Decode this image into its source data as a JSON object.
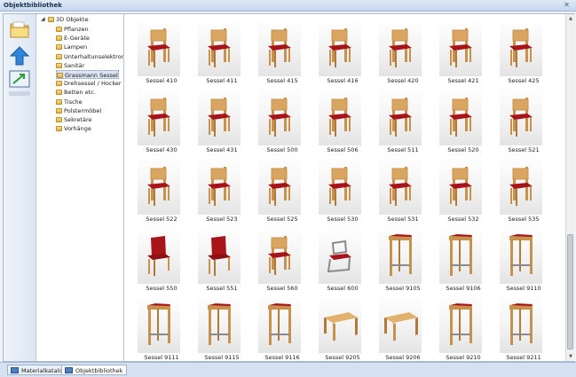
{
  "window": {
    "title": "Objektbibliothek"
  },
  "toolbar": {
    "items": [
      "folder-icon",
      "up-arrow-icon",
      "image-resize-icon"
    ]
  },
  "tree": {
    "root": "3D Objekte",
    "items": [
      "Pflanzen",
      "E-Geräte",
      "Lampen",
      "Unterhaltunselektronik",
      "Sanitär",
      "Grassmann Sessel",
      "Drehsessel / Hocker",
      "Betten etc.",
      "Tische",
      "Polstermöbel",
      "Sekretäre",
      "Vorhänge"
    ],
    "selected": "Grassmann Sessel"
  },
  "grid": {
    "items": [
      {
        "label": "Sessel 410",
        "kind": "chair"
      },
      {
        "label": "Sessel 411",
        "kind": "chair"
      },
      {
        "label": "Sessel 415",
        "kind": "chair"
      },
      {
        "label": "Sessel 416",
        "kind": "chair"
      },
      {
        "label": "Sessel 420",
        "kind": "chair"
      },
      {
        "label": "Sessel 421",
        "kind": "chair"
      },
      {
        "label": "Sessel 425",
        "kind": "chair"
      },
      {
        "label": "Sessel 430",
        "kind": "chair"
      },
      {
        "label": "Sessel 431",
        "kind": "chair"
      },
      {
        "label": "Sessel 500",
        "kind": "chair"
      },
      {
        "label": "Sessel 506",
        "kind": "chair"
      },
      {
        "label": "Sessel 511",
        "kind": "chair"
      },
      {
        "label": "Sessel 520",
        "kind": "chair"
      },
      {
        "label": "Sessel 521",
        "kind": "chair"
      },
      {
        "label": "Sessel 522",
        "kind": "chair"
      },
      {
        "label": "Sessel 523",
        "kind": "chair"
      },
      {
        "label": "Sessel 525",
        "kind": "chair"
      },
      {
        "label": "Sessel 530",
        "kind": "chair"
      },
      {
        "label": "Sessel 531",
        "kind": "chair"
      },
      {
        "label": "Sessel 532",
        "kind": "chair"
      },
      {
        "label": "Sessel 535",
        "kind": "chair"
      },
      {
        "label": "Sessel 550",
        "kind": "upholstered"
      },
      {
        "label": "Sessel 551",
        "kind": "upholstered"
      },
      {
        "label": "Sessel 560",
        "kind": "chair"
      },
      {
        "label": "Sessel 600",
        "kind": "cantilever"
      },
      {
        "label": "Sessel 9105",
        "kind": "stool"
      },
      {
        "label": "Sessel 9106",
        "kind": "stool"
      },
      {
        "label": "Sessel 9110",
        "kind": "stool"
      },
      {
        "label": "Sessel 9111",
        "kind": "stool"
      },
      {
        "label": "Sessel 9115",
        "kind": "stool"
      },
      {
        "label": "Sessel 9116",
        "kind": "stool"
      },
      {
        "label": "Sessel 9205",
        "kind": "bench"
      },
      {
        "label": "Sessel 9206",
        "kind": "bench"
      },
      {
        "label": "Sessel 9210",
        "kind": "stool"
      },
      {
        "label": "Sessel 9211",
        "kind": "stool"
      }
    ]
  },
  "statusbar": {
    "tabs": [
      "Materialkatalog",
      "Objektbibliothek"
    ],
    "active": "Objektbibliothek"
  },
  "colors": {
    "wood": "#c8924c",
    "seat": "#a8141a",
    "metal": "#8a8a8a"
  }
}
